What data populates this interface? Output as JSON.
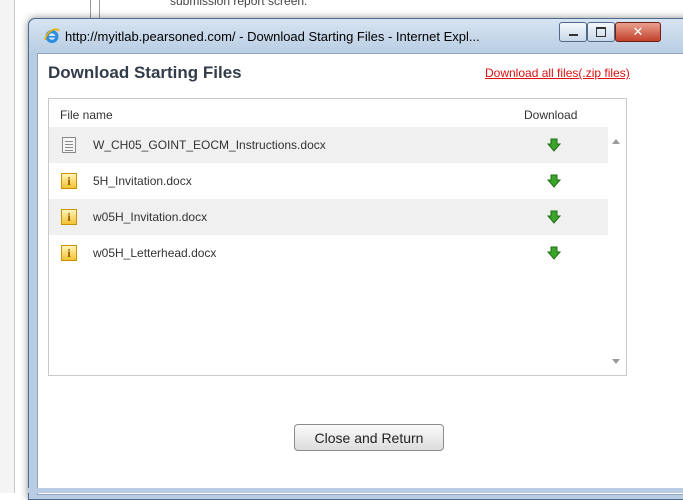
{
  "background": {
    "snippet": "submission report screen."
  },
  "window": {
    "title": "http://myitlab.pearsoned.com/ - Download Starting Files - Internet Expl...",
    "browser_icon": "internet-explorer-icon",
    "controls": {
      "minimize_icon": "minimize-icon",
      "maximize_icon": "maximize-icon",
      "close_glyph": "✕"
    }
  },
  "dialog": {
    "heading": "Download Starting Files",
    "download_all_label": "Download all files(.zip files)",
    "table": {
      "headers": {
        "name": "File name",
        "download": "Download"
      },
      "files": [
        {
          "name": "W_CH05_GOINT_EOCM_Instructions.docx",
          "icon": "document-icon"
        },
        {
          "name": "5H_Invitation.docx",
          "icon": "info-icon"
        },
        {
          "name": "w05H_Invitation.docx",
          "icon": "info-icon"
        },
        {
          "name": "w05H_Letterhead.docx",
          "icon": "info-icon"
        }
      ],
      "download_icon": "green-download-arrow-icon"
    },
    "close_button_label": "Close and Return"
  },
  "colors": {
    "link_red": "#dd1111",
    "download_green": "#3aa52a",
    "heading_text": "#333c4a",
    "window_frame": "#b8cde4"
  }
}
